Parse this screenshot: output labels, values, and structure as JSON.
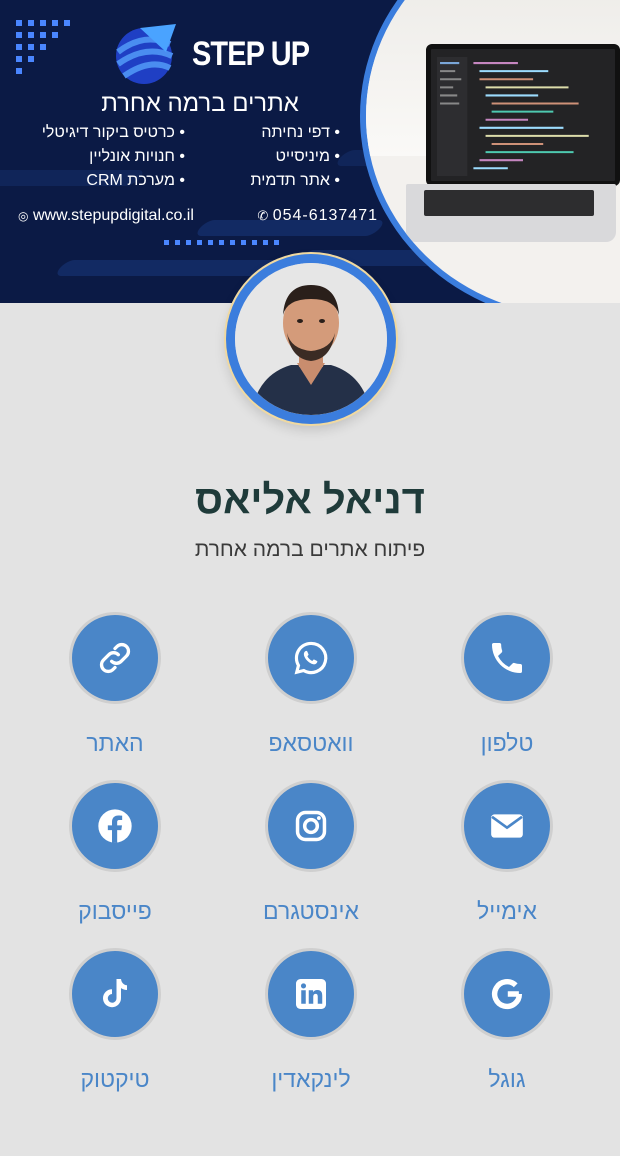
{
  "banner": {
    "brand": "STEP UP",
    "tagline": "אתרים ברמה אחרת",
    "services": [
      "דפי נחיתה",
      "כרטיס ביקור דיגיטלי",
      "מיניסייט",
      "חנויות אונליין",
      "אתר תדמית",
      "מערכת CRM"
    ],
    "website": "www.stepupdigital.co.il",
    "phone": "054-6137471"
  },
  "profile": {
    "name": "דניאל אליאס",
    "title": "פיתוח אתרים ברמה אחרת"
  },
  "actions": [
    {
      "label": "טלפון",
      "icon": "phone-icon"
    },
    {
      "label": "וואטסאפ",
      "icon": "whatsapp-icon"
    },
    {
      "label": "האתר",
      "icon": "link-icon"
    },
    {
      "label": "אימייל",
      "icon": "envelope-icon"
    },
    {
      "label": "אינסטגרם",
      "icon": "instagram-icon"
    },
    {
      "label": "פייסבוק",
      "icon": "facebook-icon"
    },
    {
      "label": "גוגל",
      "icon": "google-icon"
    },
    {
      "label": "לינקאדין",
      "icon": "linkedin-icon"
    },
    {
      "label": "טיקטוק",
      "icon": "tiktok-icon"
    }
  ],
  "colors": {
    "accent": "#4a86c8",
    "banner_bg": "#0b1a45",
    "page_bg": "#e3e3e3",
    "name_color": "#1f3b3a"
  }
}
